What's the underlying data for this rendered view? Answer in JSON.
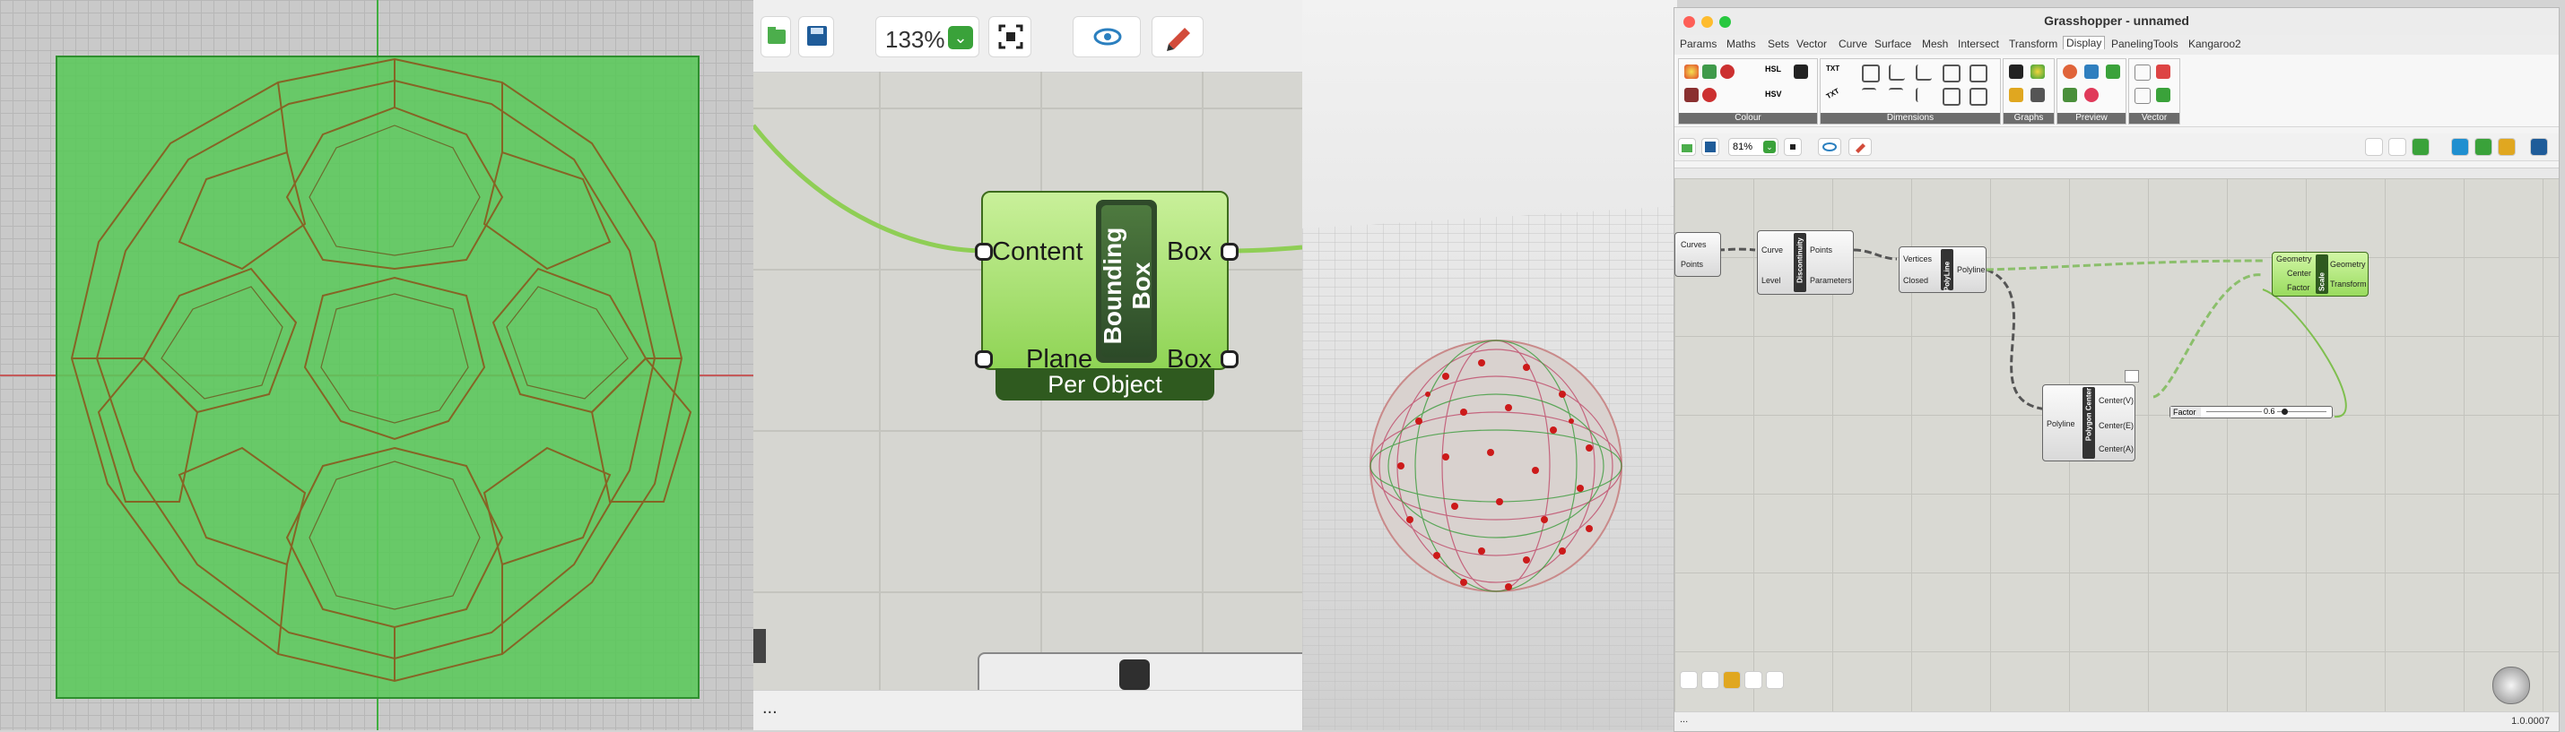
{
  "zoomed_view": {
    "zoom_value": "133%",
    "component": {
      "title": "Bounding Box",
      "inputs": [
        "Content",
        "Plane"
      ],
      "outputs": [
        "Box",
        "Box"
      ],
      "mode": "Per Object"
    },
    "status_text": "..."
  },
  "gh_window": {
    "title": "Grasshopper - unnamed",
    "menu_tabs": [
      "Params",
      "Maths",
      "Sets",
      "Vector",
      "Curve",
      "Surface",
      "Mesh",
      "Intersect",
      "Transform",
      "Display",
      "PanelingTools",
      "Kangaroo2"
    ],
    "active_tab": "Display",
    "ribbon_groups": [
      "Colour",
      "Dimensions",
      "Graphs",
      "Preview",
      "Vector"
    ],
    "ribbon_small_labels": [
      "HSL",
      "HSV",
      "TXT",
      "TXT"
    ],
    "zoom_value": "81%",
    "nodes": {
      "explode": {
        "inputs": [
          "Curves"
        ],
        "outputs": [
          "Points"
        ]
      },
      "discontinuity": {
        "title": "Discontinuity",
        "inputs": [
          "Curve",
          "Level"
        ],
        "outputs": [
          "Points",
          "Parameters"
        ]
      },
      "polyline": {
        "title": "PolyLine",
        "inputs": [
          "Vertices",
          "Closed"
        ],
        "outputs": [
          "Polyline"
        ]
      },
      "polygon_center": {
        "title": "Polygon Center",
        "inputs": [
          "Polyline"
        ],
        "outputs": [
          "Center(V)",
          "Center(E)",
          "Center(A)"
        ]
      },
      "scale": {
        "title": "Scale",
        "inputs": [
          "Geometry",
          "Center",
          "Factor"
        ],
        "outputs": [
          "Geometry",
          "Transform"
        ]
      },
      "slider": {
        "label": "Factor",
        "value": "0.6"
      }
    },
    "status_text": "...",
    "version": "1.0.0007"
  },
  "colors": {
    "gh_green": "#8fd455",
    "bbox_green": "#5ac85a",
    "curve_brown": "#8a5a1e",
    "wire_green": "#7fbf4f",
    "point_red": "#cc1a1a"
  }
}
